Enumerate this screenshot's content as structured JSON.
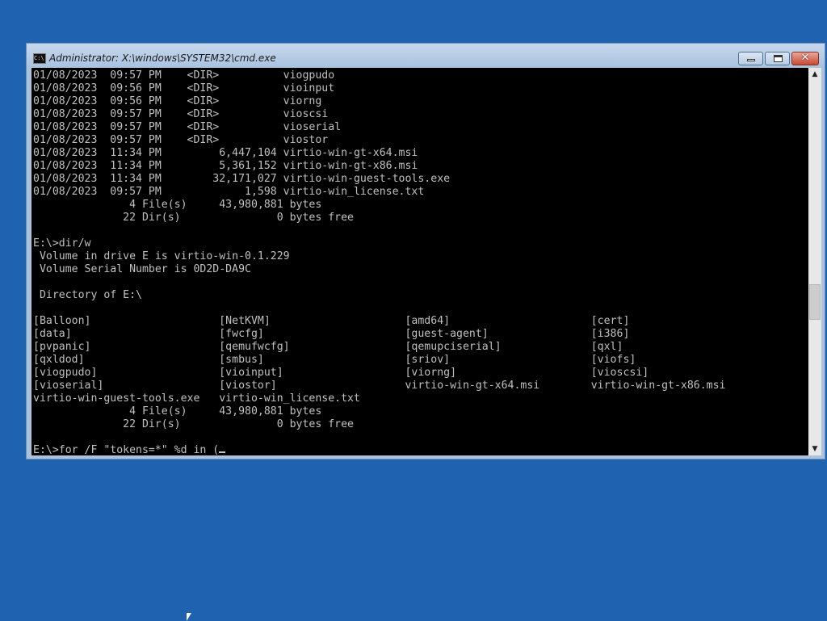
{
  "window": {
    "title": "Administrator: X:\\windows\\SYSTEM32\\cmd.exe",
    "close_glyph": "✕",
    "icon_text": "C:\\"
  },
  "console": {
    "lines": [
      "01/08/2023  09:57 PM    <DIR>          viogpudo",
      "01/08/2023  09:56 PM    <DIR>          vioinput",
      "01/08/2023  09:56 PM    <DIR>          viorng",
      "01/08/2023  09:57 PM    <DIR>          vioscsi",
      "01/08/2023  09:57 PM    <DIR>          vioserial",
      "01/08/2023  09:57 PM    <DIR>          viostor",
      "01/08/2023  11:34 PM         6,447,104 virtio-win-gt-x64.msi",
      "01/08/2023  11:34 PM         5,361,152 virtio-win-gt-x86.msi",
      "01/08/2023  11:34 PM        32,171,027 virtio-win-guest-tools.exe",
      "01/08/2023  09:57 PM             1,598 virtio-win_license.txt",
      "               4 File(s)     43,980,881 bytes",
      "              22 Dir(s)               0 bytes free",
      "",
      "E:\\>dir/w",
      " Volume in drive E is virtio-win-0.1.229",
      " Volume Serial Number is 0D2D-DA9C",
      "",
      " Directory of E:\\",
      "",
      "[Balloon]                    [NetKVM]                     [amd64]                      [cert]",
      "[data]                       [fwcfg]                      [guest-agent]                [i386]",
      "[pvpanic]                    [qemufwcfg]                  [qemupciserial]              [qxl]",
      "[qxldod]                     [smbus]                      [sriov]                      [viofs]",
      "[viogpudo]                   [vioinput]                   [viorng]                     [vioscsi]",
      "[vioserial]                  [viostor]                    virtio-win-gt-x64.msi        virtio-win-gt-x86.msi",
      "virtio-win-guest-tools.exe   virtio-win_license.txt",
      "               4 File(s)     43,980,881 bytes",
      "              22 Dir(s)               0 bytes free",
      ""
    ],
    "prompt_input": "E:\\>for /F \"tokens=*\" %d in ("
  },
  "scrollbar": {
    "up_arrow": "▲",
    "down_arrow": "▼"
  }
}
